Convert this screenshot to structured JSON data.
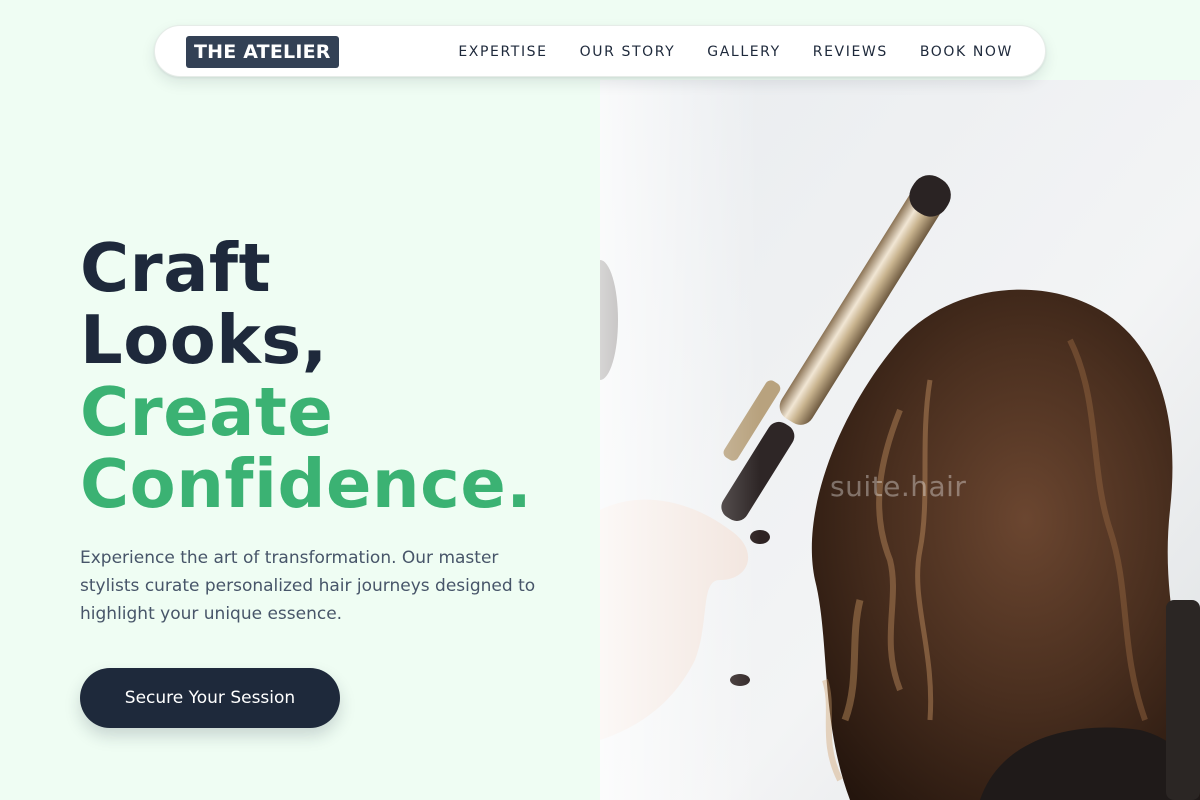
{
  "brand": {
    "logo_text": "THE ATELIER"
  },
  "nav": {
    "items": [
      {
        "label": "EXPERTISE"
      },
      {
        "label": "OUR STORY"
      },
      {
        "label": "GALLERY"
      },
      {
        "label": "REVIEWS"
      },
      {
        "label": "BOOK NOW"
      }
    ]
  },
  "hero": {
    "title_line1": "Craft",
    "title_line2": "Looks,",
    "title_line3": "Create",
    "title_line4": "Confidence.",
    "description": "Experience the art of transformation. Our master stylists curate personalized hair journeys designed to highlight your unique essence.",
    "cta_label": "Secure Your Session",
    "image_watermark": "suite.hair",
    "image_subject": "stylist curling long brown hair with a curling iron"
  },
  "colors": {
    "background": "#effdf3",
    "navy": "#1e293b",
    "accent_green": "#3bb273",
    "body_text": "#475569",
    "logo_bg": "#334155"
  }
}
